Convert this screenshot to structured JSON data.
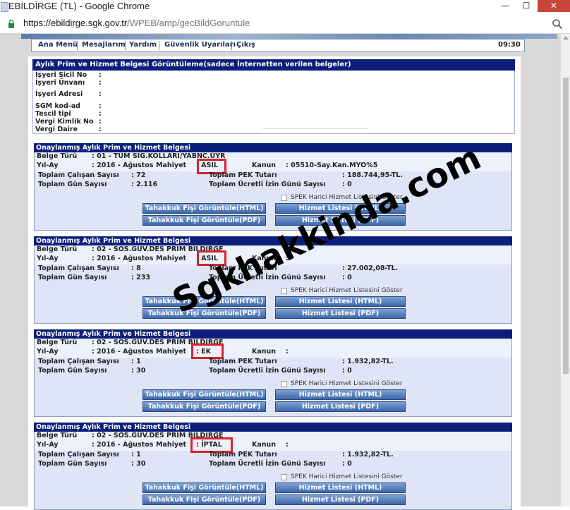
{
  "window": {
    "title": "EBİLDİRGE (TL) - Google Chrome",
    "minimize_glyph": "—",
    "maximize_glyph": "☐",
    "close_glyph": "✕"
  },
  "address_bar": {
    "url_host": "https://ebildirge.sgk.gov.tr",
    "url_path": "/WPEB/amp/gecBildGoruntule",
    "lock_icon": "lock-icon",
    "zoom_icon": "magnifier-icon"
  },
  "menu": {
    "items": [
      "Ana Menü",
      "Mesajlarım",
      "Yardım",
      "Güvenlik Uyarıları",
      "Çıkış"
    ],
    "time": "09:30"
  },
  "main": {
    "header": "Aylık Prim ve Hizmet Belgesi Görüntüleme(sadece İnternetten verilen belgeler)",
    "colon": ":",
    "info_labels": [
      "İşyeri Sicil No",
      "İşyeri Ünvanı",
      "İşyeri Adresi",
      "SGM kod-ad",
      "Tescil tipi",
      "Vergi Kimlik No",
      "Vergi Daire"
    ]
  },
  "labels": {
    "header": "Onaylanmış Aylık Prim ve Hizmet Belgesi",
    "belge_turu": "Belge Türü",
    "yil_ay": "Yıl-Ay",
    "mahiyet": "Mahiyet",
    "kanun": "Kanun",
    "calisan": "Toplam Çalışan Sayısı",
    "gun": "Toplam Gün Sayısı",
    "pek": "Toplam PEK Tutarı",
    "izin": "Toplam Ücretli İzin Günü Sayısı",
    "spek": "SPEK Harici Hizmet Listesini Göster",
    "btn_tahakkuk_html": "Tahakkuk Fişi Görüntüle(HTML)",
    "btn_tahakkuk_pdf": "Tahakkuk Fişi Görüntüle(PDF)",
    "btn_hizmet_html": "Hizmet Listesi (HTML)",
    "btn_hizmet_pdf": "Hizmet Listesi (PDF)"
  },
  "blocks": [
    {
      "belge": ": 01 - TÜM SİG.KOLLARI/YABNC.UYR",
      "yilay": ": 2016 - Ağustos",
      "mahiyet": ": ASIL",
      "kanun": ":   05510-Say.Kan.MYO%5",
      "calisan": ":   72",
      "gun": ":   2.116",
      "pek": ":   188.744,95-TL.",
      "izin": ":   0"
    },
    {
      "belge": ": 02 - SOS.GÜV.DES PRİM BİLDİRGE",
      "yilay": ": 2016 - Ağustos",
      "mahiyet": ": ASIL",
      "kanun": ":",
      "calisan": ":   8",
      "gun": ":   233",
      "pek": ":   27.002,08-TL.",
      "izin": ":   0"
    },
    {
      "belge": ": 02 - SOS.GÜV.DES PRİM BİLDİRGE",
      "yilay": ": 2016 - Ağustos",
      "mahiyet": ": EK",
      "kanun": ":",
      "calisan": ":   1",
      "gun": ":   30",
      "pek": ":   1.932,82-TL.",
      "izin": ":   0"
    },
    {
      "belge": ": 02 - SOS.GÜV.DES PRİM BİLDİRGE",
      "yilay": ": 2016 - Ağustos",
      "mahiyet": ": İPTAL",
      "kanun": ":",
      "calisan": ":   1",
      "gun": ":   30",
      "pek": ":   1.932,82-TL.",
      "izin": ":   0"
    }
  ],
  "watermark": "Sgkhakkinda.com",
  "colors": {
    "header_navy": "#0b1f7a",
    "highlight_red": "#d8232a",
    "button_blue": "#3c67a8"
  }
}
